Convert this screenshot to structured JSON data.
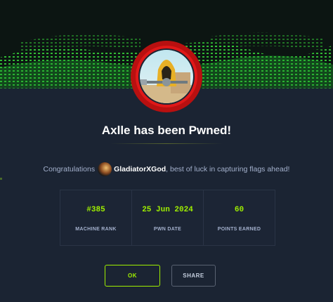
{
  "modal": {
    "title": "Axlle has been Pwned!",
    "congrats_prefix": "Congratulations",
    "username": "GladiatorXGod",
    "congrats_suffix": ", best of luck in capturing flags ahead!",
    "stats": [
      {
        "value": "#385",
        "label": "MACHINE RANK"
      },
      {
        "value": "25 Jun 2024",
        "label": "PWN DATE"
      },
      {
        "value": "60",
        "label": "POINTS EARNED"
      }
    ],
    "buttons": {
      "ok": "OK",
      "share": "SHARE"
    }
  },
  "colors": {
    "accent": "#9fef00",
    "badge_ring": "#e01818",
    "background": "#1b2433"
  },
  "icons": {
    "badge": "hooded-figure-machine-badge",
    "avatar": "user-avatar"
  }
}
